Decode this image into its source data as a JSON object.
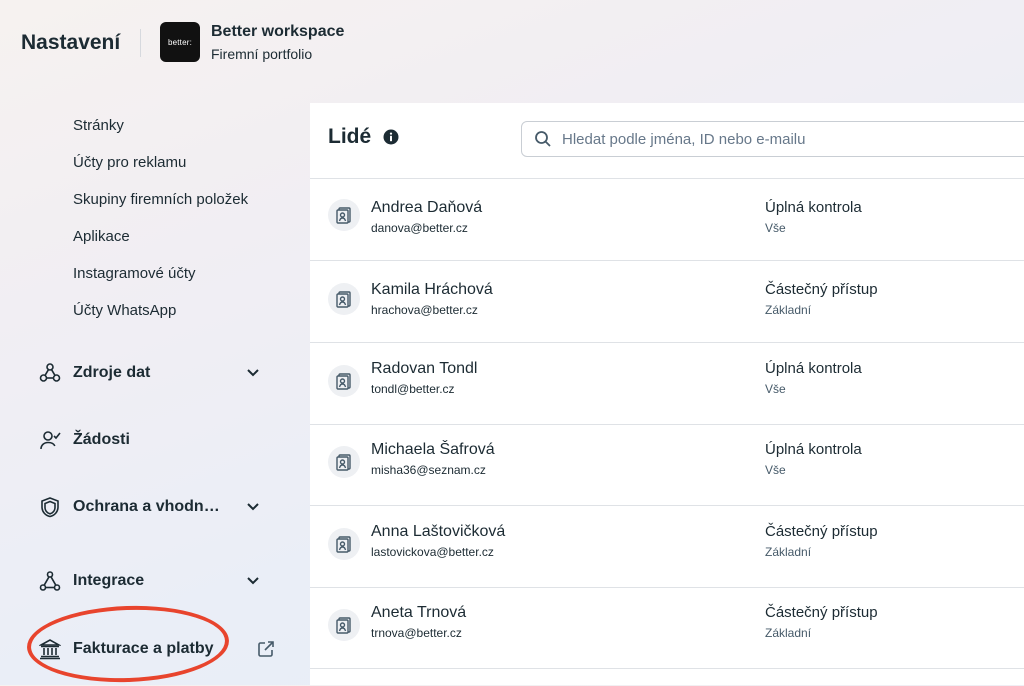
{
  "header": {
    "title": "Nastavení",
    "logo_text": "better:",
    "workspace_name": "Better workspace",
    "workspace_sub": "Firemní portfolio"
  },
  "sidebar": {
    "sub_items": [
      "Stránky",
      "Účty pro reklamu",
      "Skupiny firemních položek",
      "Aplikace",
      "Instagramové účty",
      "Účty WhatsApp"
    ],
    "sections": [
      {
        "label": "Zdroje dat",
        "icon": "data-sources-icon",
        "expandable": true
      },
      {
        "label": "Žádosti",
        "icon": "person-check-icon",
        "expandable": false
      },
      {
        "label": "Ochrana a vhodn…",
        "icon": "shield-icon",
        "expandable": true
      },
      {
        "label": "Integrace",
        "icon": "integration-icon",
        "expandable": true
      },
      {
        "label": "Fakturace a platby",
        "icon": "bank-icon",
        "expandable": false,
        "external": true
      }
    ],
    "highlight_color": "#e8442d"
  },
  "main": {
    "title": "Lidé",
    "search_placeholder": "Hledat podle jména, ID nebo e-mailu",
    "people": [
      {
        "name": "Andrea Daňová",
        "email": "danova@better.cz",
        "role": "Úplná kontrola",
        "scope": "Vše"
      },
      {
        "name": "Kamila Hráchová",
        "email": "hrachova@better.cz",
        "role": "Částečný přístup",
        "scope": "Základní"
      },
      {
        "name": "Radovan Tondl",
        "email": "tondl@better.cz",
        "role": "Úplná kontrola",
        "scope": "Vše"
      },
      {
        "name": "Michaela Šafrová",
        "email": "misha36@seznam.cz",
        "role": "Úplná kontrola",
        "scope": "Vše"
      },
      {
        "name": "Anna Laštovičková",
        "email": "lastovickova@better.cz",
        "role": "Částečný přístup",
        "scope": "Základní"
      },
      {
        "name": "Aneta Trnová",
        "email": "trnova@better.cz",
        "role": "Částečný přístup",
        "scope": "Základní"
      }
    ]
  }
}
